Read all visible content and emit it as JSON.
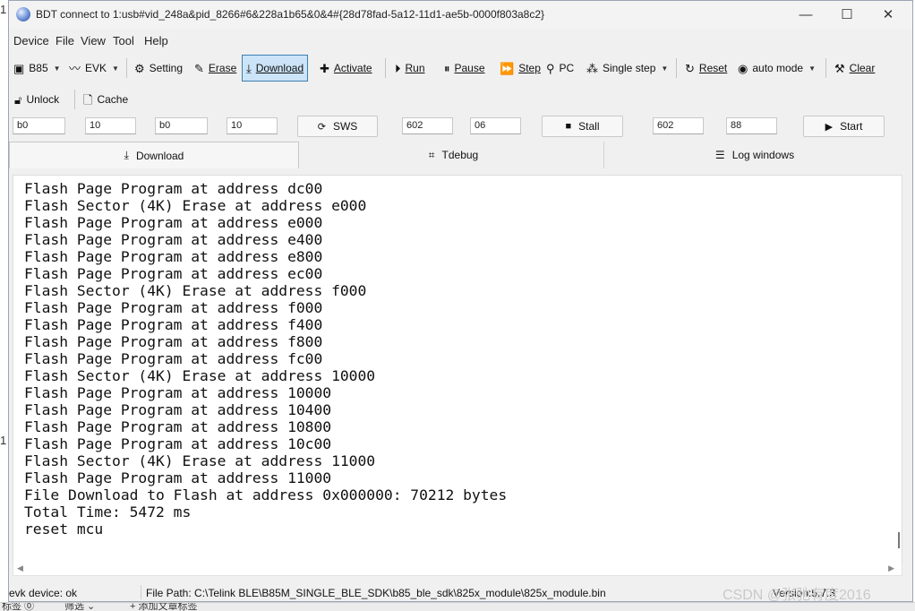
{
  "window": {
    "title": "BDT connect to 1:usb#vid_248a&pid_8266#6&228a1b65&0&4#{28d78fad-5a12-11d1-ae5b-0000f803a8c2}",
    "controls": {
      "minimize": "—",
      "maximize": "☐",
      "close": "✕"
    }
  },
  "menu": [
    "Device",
    "File",
    "View",
    "Tool",
    "Help"
  ],
  "toolbar": {
    "chip": "B85",
    "board": "EVK",
    "setting": "Setting",
    "erase": "Erase",
    "download": "Download",
    "activate": "Activate",
    "run": "Run",
    "pause": "Pause",
    "step": "Step",
    "pc": "PC",
    "single_step": "Single step",
    "reset": "Reset",
    "auto_mode": "auto mode",
    "clear": "Clear"
  },
  "toolbar2": {
    "unlock": "Unlock",
    "cache": "Cache"
  },
  "inputs": {
    "f1": "b0",
    "f2": "10",
    "f3": "b0",
    "f4": "10",
    "sws_label": "SWS",
    "f5": "602",
    "f6": "06",
    "stall_label": "Stall",
    "f7": "602",
    "f8": "88",
    "start_label": "Start"
  },
  "tabs": [
    "Download",
    "Tdebug",
    "Log windows"
  ],
  "log": [
    "Flash Page Program at address dc00",
    "Flash Sector (4K) Erase at address e000",
    "Flash Page Program at address e000",
    "Flash Page Program at address e400",
    "Flash Page Program at address e800",
    "Flash Page Program at address ec00",
    "Flash Sector (4K) Erase at address f000",
    "Flash Page Program at address f000",
    "Flash Page Program at address f400",
    "Flash Page Program at address f800",
    "Flash Page Program at address fc00",
    "Flash Sector (4K) Erase at address 10000",
    "Flash Page Program at address 10000",
    "Flash Page Program at address 10400",
    "Flash Page Program at address 10800",
    "Flash Page Program at address 10c00",
    "Flash Sector (4K) Erase at address 11000",
    "Flash Page Program at address 11000",
    "File Download to Flash at address 0x000000: 70212 bytes",
    "Total Time: 5472 ms",
    "reset mcu"
  ],
  "status": {
    "device": "evk device: ok",
    "file_path": "File Path:  C:\\Telink BLE\\B85M_SINGLE_BLE_SDK\\b85_ble_sdk\\825x_module\\825x_module.bin",
    "version": "Version:5.7.3"
  },
  "watermark": "CSDN @张驰有度2016",
  "edge": {
    "left_glyphs": [
      "1",
      "1"
    ],
    "bottom_fragments": [
      "标签 ⓪",
      "筛选 ⌄",
      "+ 添加文章标签"
    ]
  }
}
